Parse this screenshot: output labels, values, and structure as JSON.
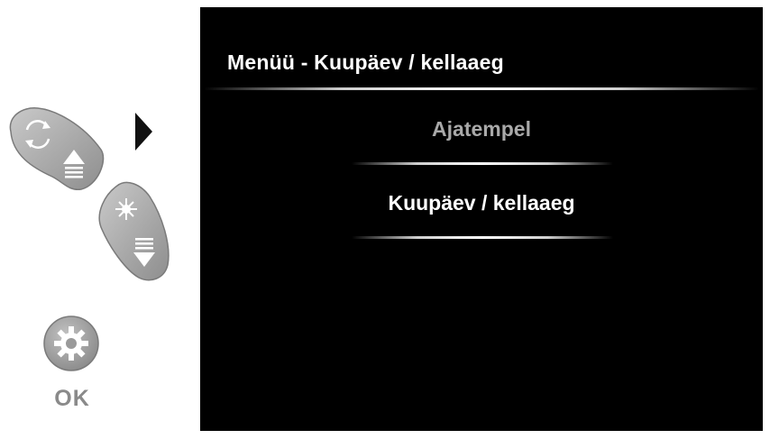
{
  "screen": {
    "title": "Menüü - Kuupäev / kellaaeg",
    "items": [
      {
        "label": "Ajatempel",
        "selected": false,
        "color": "#a9a9a9"
      },
      {
        "label": "Kuupäev / kellaaeg",
        "selected": true,
        "color": "#ffffff"
      }
    ]
  },
  "controls": {
    "up_button_icon": "rotate-up-icon",
    "down_button_icon": "brightness-down-icon",
    "ok_button_icon": "gear-icon",
    "ok_label": "OK",
    "pointer_icon": "triangle-right-icon"
  }
}
